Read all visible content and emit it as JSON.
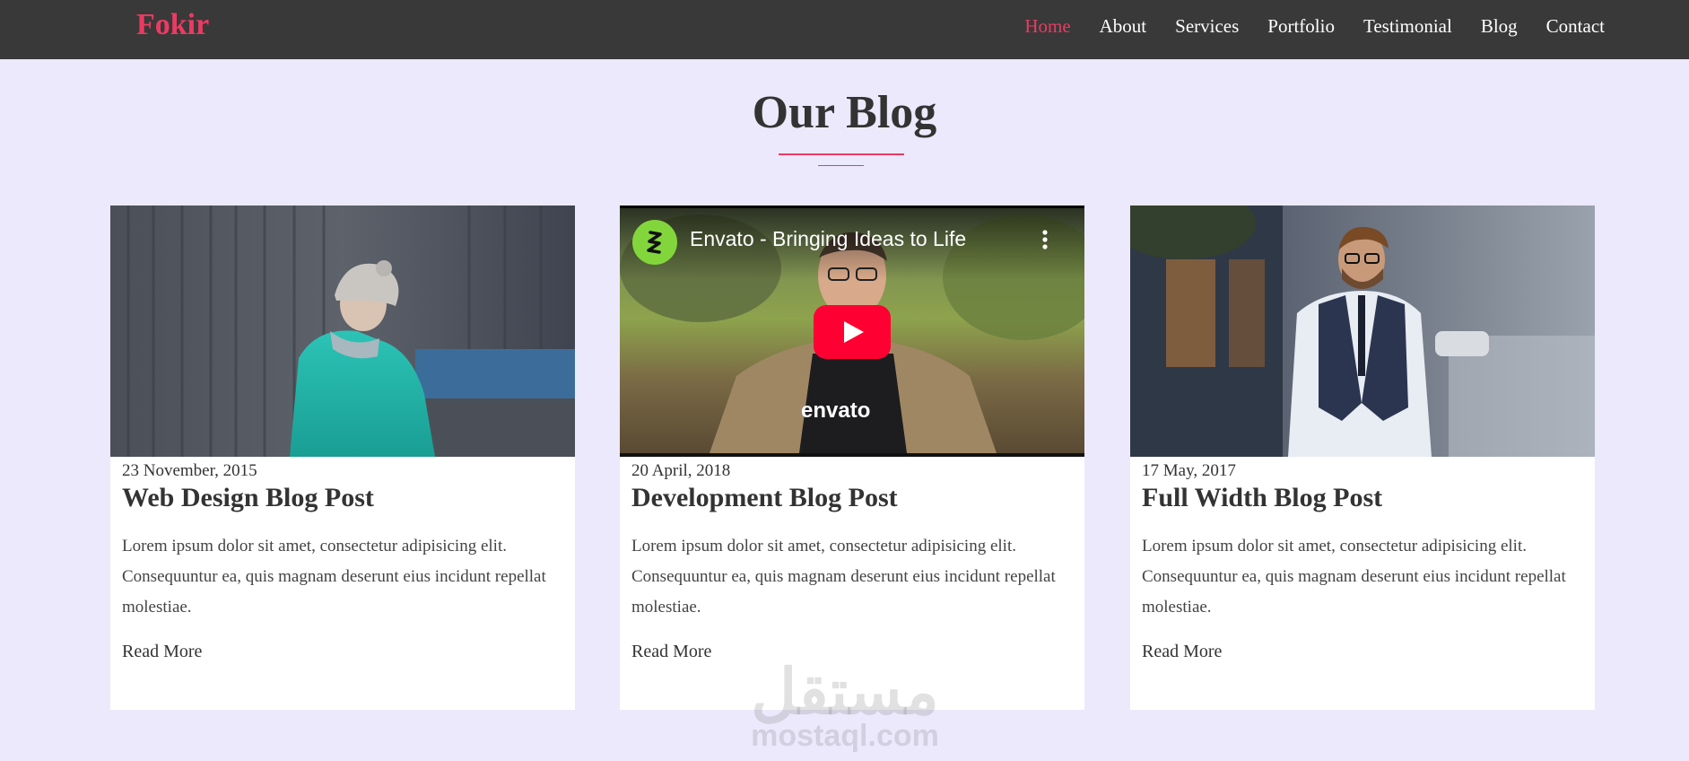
{
  "header": {
    "brand": "Fokir",
    "nav": [
      {
        "label": "Home",
        "active": true
      },
      {
        "label": "About",
        "active": false
      },
      {
        "label": "Services",
        "active": false
      },
      {
        "label": "Portfolio",
        "active": false
      },
      {
        "label": "Testimonial",
        "active": false
      },
      {
        "label": "Blog",
        "active": false
      },
      {
        "label": "Contact",
        "active": false
      }
    ]
  },
  "section": {
    "title": "Our Blog"
  },
  "posts": [
    {
      "date": "23 November, 2015",
      "title": "Web Design Blog Post",
      "excerpt": "Lorem ipsum dolor sit amet, consectetur adipisicing elit. Consequuntur ea, quis magnam deserunt eius incidunt repellat molestiae.",
      "read_more": "Read More"
    },
    {
      "date": "20 April, 2018",
      "title": "Development Blog Post",
      "excerpt": "Lorem ipsum dolor sit amet, consectetur adipisicing elit. Consequuntur ea, quis magnam deserunt eius incidunt repellat molestiae.",
      "read_more": "Read More",
      "video": {
        "title": "Envato - Bringing Ideas to Life",
        "shirt_text": "envato"
      }
    },
    {
      "date": "17 May, 2017",
      "title": "Full Width Blog Post",
      "excerpt": "Lorem ipsum dolor sit amet, consectetur adipisicing elit. Consequuntur ea, quis magnam deserunt eius incidunt repellat molestiae.",
      "read_more": "Read More"
    }
  ],
  "watermark": {
    "arabic": "مستقل",
    "latin": "mostaql.com"
  },
  "colors": {
    "accent": "#ec3a63",
    "nav_bg": "#393939",
    "page_bg": "#ece9fc"
  }
}
